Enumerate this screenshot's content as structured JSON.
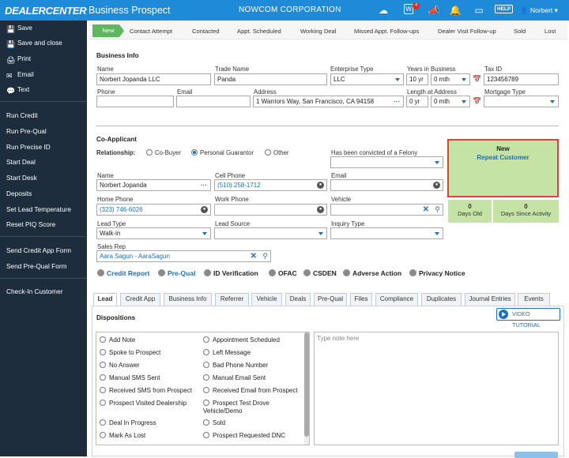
{
  "header": {
    "brand": "DEALERCENTER",
    "page_title": "Business Prospect",
    "corporation": "NOWCOM CORPORATION",
    "notification_count": "4",
    "help_label": "HELP",
    "user": "Norbert"
  },
  "sidebar": {
    "top_items": [
      "Save",
      "Save and close",
      "Print",
      "Email",
      "Text"
    ],
    "actions": [
      "Run Credit",
      "Run Pre-Qual",
      "Run Precise ID",
      "Start Deal",
      "Start Desk",
      "Deposits",
      "Set Lead Temperature",
      "Reset PIQ Score"
    ],
    "forms": [
      "Send Credit App Form",
      "Send Pre-Qual Form"
    ],
    "checkin": "Check-In Customer"
  },
  "steps": {
    "active": "New",
    "items": [
      "Contact Attempt",
      "Contacted",
      "Appt. Scheduled",
      "Working Deal",
      "Missed Appt. Follow-ups",
      "Dealer Visit Follow-up",
      "Sold",
      "Lost"
    ]
  },
  "business": {
    "section": "Business Info",
    "name_label": "Name",
    "name": "Norbert Jopanda LLC",
    "trade_label": "Trade Name",
    "trade": "Panda",
    "ent_label": "Enterprise Type",
    "ent": "LLC",
    "yib_label": "Years in Business",
    "yib_yr": "10 yr",
    "yib_mth": "0 mth",
    "tax_label": "Tax ID",
    "tax": "123456789",
    "phone_label": "Phone",
    "email_label": "Email",
    "addr_label": "Address",
    "addr": "1 Warriors Way, San Francisco, CA 94158",
    "loa_label": "Length at Address",
    "loa_yr": "0 yr",
    "loa_mth": "0 mth",
    "mort_label": "Mortgage Type"
  },
  "coapp": {
    "section": "Co-Applicant",
    "rel_label": "Relationship:",
    "rel_options": [
      "Co-Buyer",
      "Personal Guarantor",
      "Other"
    ],
    "felony_label": "Has been convicted of a Felony",
    "name_label": "Name",
    "name": "Norbert Jopanda",
    "cell_label": "Cell Phone",
    "cell": "(510) 258-1712",
    "email_label": "Email",
    "home_label": "Home Phone",
    "home": "(323) 746-6026",
    "work_label": "Work Phone",
    "vehicle_label": "Vehicle",
    "lt_label": "Lead Type",
    "lt": "Walk-in",
    "ls_label": "Lead Source",
    "inq_label": "Inquiry Type",
    "rep_label": "Sales Rep",
    "rep": "Aara Sagun - AaraSagun"
  },
  "status": {
    "title": "New",
    "subtitle": "Repeat Customer",
    "days_old": "0",
    "days_old_label": "Days Old",
    "days_act": "0",
    "days_act_label": "Days Since Activity"
  },
  "checks": [
    "Credit Report",
    "Pre-Qual",
    "ID Verification",
    "OFAC",
    "CSDEN",
    "Adverse Action",
    "Privacy Notice"
  ],
  "tabs": [
    "Lead",
    "Credit App",
    "Business Info",
    "Referrer",
    "Vehicle",
    "Deals",
    "Pre-Qual",
    "Files",
    "Compliance",
    "Duplicates",
    "Journal Entries",
    "Events"
  ],
  "dispositions": {
    "title": "Dispositions",
    "video": "VIDEO TUTORIAL",
    "note_placeholder": "Type note here",
    "left": [
      "Add Note",
      "Spoke to Prospect",
      "No Answer",
      "Manual SMS Sent",
      "Received SMS from Prospect",
      "Prospect Visited Dealership",
      "Deal In Progress",
      "Mark As Lost"
    ],
    "right": [
      "Appointment Scheduled",
      "Left Message",
      "Bad Phone Number",
      "Manual Email Sent",
      "Received Email from Prospect",
      "Prospect Test Drove Vehicle/Demo",
      "Sold",
      "Prospect Requested DNC"
    ]
  },
  "colors": {
    "header": "#1f8ad8",
    "sidebar": "#1d2d3d",
    "accent": "#1f6fb8",
    "status_bg": "#c6e3a6",
    "highlight": "#e04040",
    "step_active": "#5cb85c"
  }
}
